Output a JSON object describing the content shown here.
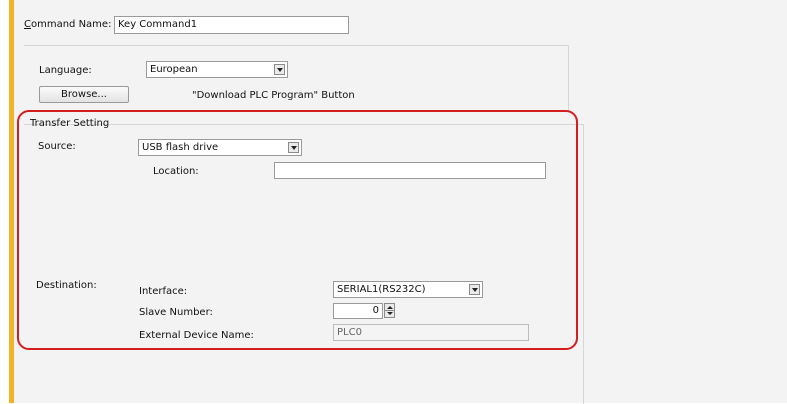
{
  "command_name": {
    "label": "Command Name:",
    "value": "Key Command1"
  },
  "language": {
    "label": "Language:",
    "value": "European"
  },
  "browse_button": {
    "label": "Browse..."
  },
  "download_plc_program_label": "\"Download PLC Program\" Button",
  "transfer_setting": {
    "title": "Transfer Setting",
    "source": {
      "label": "Source:",
      "value": "USB flash drive"
    },
    "location": {
      "label": "Location:",
      "value": ""
    },
    "destination": {
      "label": "Destination:",
      "interface": {
        "label": "Interface:",
        "value": "SERIAL1(RS232C)"
      },
      "slave_number": {
        "label": "Slave Number:",
        "value": "0"
      },
      "external_device_name": {
        "label": "External Device Name:",
        "value": "PLC0"
      }
    }
  },
  "colors": {
    "accent": "#f0b428",
    "highlight": "#d21e1e",
    "panel": "#f3f3f3"
  }
}
